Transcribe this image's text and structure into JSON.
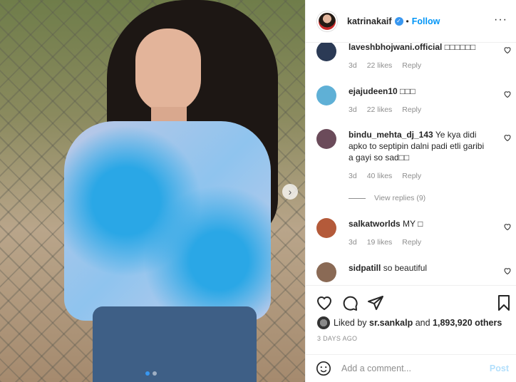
{
  "post": {
    "username": "katrinakaif",
    "separator": "•",
    "follow_label": "Follow",
    "more_label": "···",
    "next_arrow": "›"
  },
  "comments": [
    {
      "user": "laveshbhojwani.official",
      "text": "□□□□□□",
      "age": "3d",
      "likes": "22 likes",
      "reply": "Reply",
      "avatar_color": "#2b3a55"
    },
    {
      "user": "ejajudeen10",
      "text": "□□□",
      "age": "3d",
      "likes": "22 likes",
      "reply": "Reply",
      "avatar_color": "#5fb0d6"
    },
    {
      "user": "bindu_mehta_dj_143",
      "text": "Ye kya didi apko to septipin dalni padi etli garibi a gayi so sad□□",
      "age": "3d",
      "likes": "40 likes",
      "reply": "Reply",
      "avatar_color": "#6b4b5a"
    },
    {
      "user": "salkatworlds",
      "text": "MY □",
      "age": "3d",
      "likes": "19 likes",
      "reply": "Reply",
      "avatar_color": "#b45a3a"
    },
    {
      "user": "sidpatill",
      "text": "so beautiful",
      "avatar_color": "#8a6a55"
    }
  ],
  "view_replies": "View replies (9)",
  "likes": {
    "prefix": "Liked by",
    "user": "sr.sankalp",
    "conjunction": "and",
    "count": "1,893,920 others"
  },
  "timestamp": "3 DAYS AGO",
  "add_comment": {
    "placeholder": "Add a comment...",
    "post_label": "Post"
  }
}
